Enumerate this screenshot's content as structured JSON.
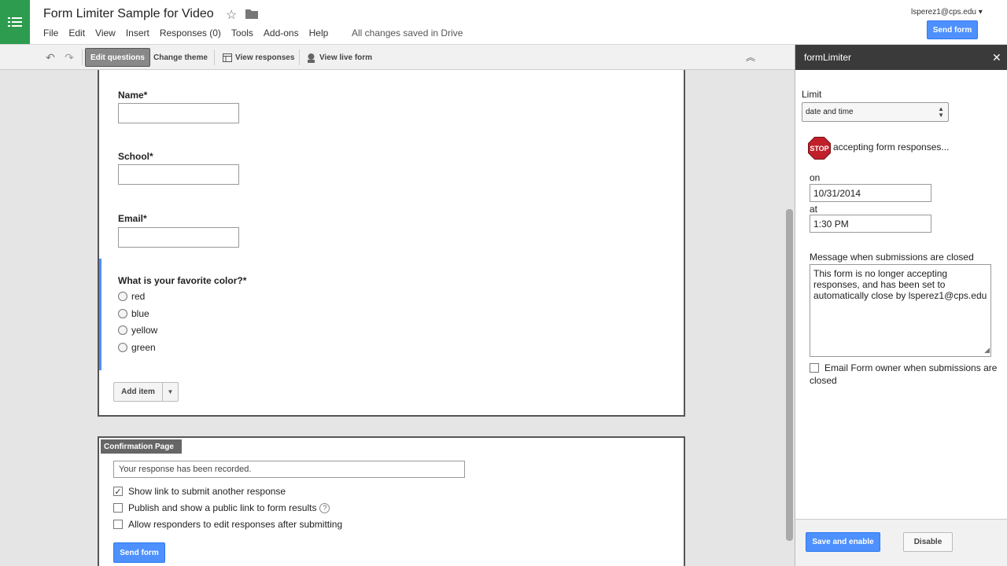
{
  "header": {
    "doc_title": "Form Limiter Sample for Video",
    "menu": [
      "File",
      "Edit",
      "View",
      "Insert",
      "Responses (0)",
      "Tools",
      "Add-ons",
      "Help"
    ],
    "save_status": "All changes saved in Drive",
    "user": "lsperez1@cps.edu ▾",
    "send_form": "Send form"
  },
  "toolbar": {
    "edit_questions": "Edit questions",
    "change_theme": "Change theme",
    "view_responses": "View responses",
    "view_live_form": "View live form"
  },
  "form": {
    "questions": [
      {
        "label": "Name*"
      },
      {
        "label": "School*"
      },
      {
        "label": "Email*"
      }
    ],
    "color_question": {
      "label": "What is your favorite color?*",
      "options": [
        "red",
        "blue",
        "yellow",
        "green"
      ]
    },
    "add_item": "Add item"
  },
  "confirmation": {
    "tab_label": "Confirmation Page",
    "message": "Your response has been recorded.",
    "options": [
      {
        "label": "Show link to submit another response",
        "checked": true
      },
      {
        "label": "Publish and show a public link to form results",
        "checked": false
      },
      {
        "label": "Allow responders to edit responses after submitting",
        "checked": false
      }
    ],
    "help_icon": "?",
    "send_form": "Send form"
  },
  "sidebar": {
    "title": "formLimiter",
    "limit_label": "Limit",
    "limit_value": "date and time",
    "stop_text": "STOP",
    "accepting_label": "accepting form responses...",
    "on_label": "on",
    "date_value": "10/31/2014",
    "at_label": "at",
    "time_value": "1:30 PM",
    "message_label": "Message when submissions are closed",
    "message_value": "This form is no longer accepting responses, and has been set to automatically close by lsperez1@cps.edu",
    "email_owner_label": "Email Form owner when submissions are closed",
    "save_enable": "Save and enable",
    "disable": "Disable"
  },
  "colors": {
    "brand_green": "#2e9c4e",
    "action_blue": "#4d90fe",
    "panel_header": "#3a3a3a",
    "stop_red": "#c0202a"
  }
}
